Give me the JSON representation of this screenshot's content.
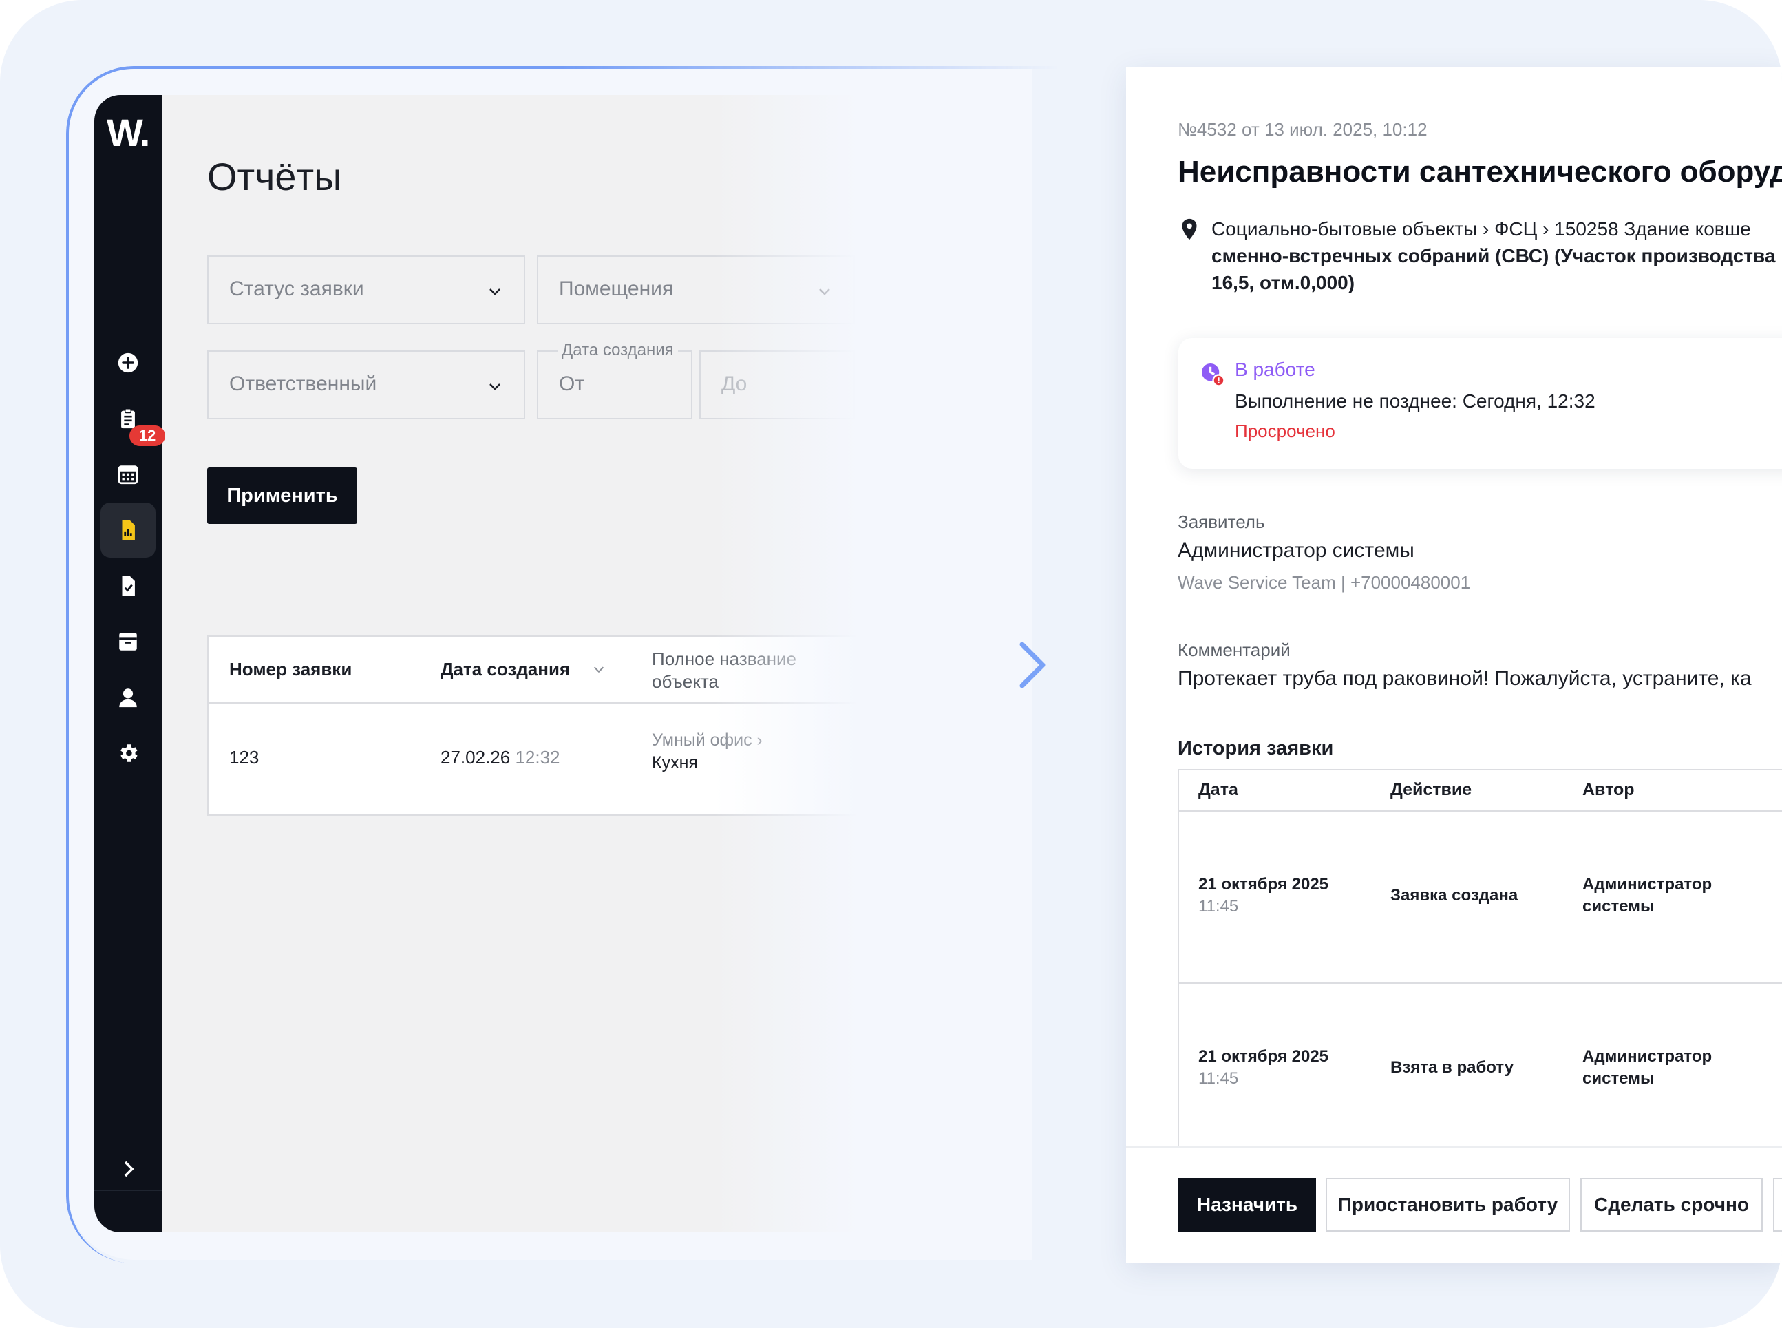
{
  "left_app": {
    "logo": "W.",
    "badge_count": "12",
    "page_title": "Отчёты",
    "filters": {
      "status_placeholder": "Статус заявки",
      "rooms_placeholder": "Помещения",
      "responsible_placeholder": "Ответственный",
      "date_group_label": "Дата создания",
      "date_from_placeholder": "От",
      "date_to_placeholder": "До"
    },
    "apply_label": "Применить",
    "table": {
      "headers": [
        "Номер заявки",
        "Дата создания",
        "Полное название объекта"
      ],
      "rows": [
        {
          "number": "123",
          "date": "27.02.26",
          "time": "12:32",
          "object_path": "Умный офис ›",
          "object_name": "Кухня"
        }
      ]
    }
  },
  "right_panel": {
    "meta": "№4532 от 13 июл. 2025, 10:12",
    "title": "Неисправности сантехнического оборуд",
    "location_line1": "Социально-бытовые объекты › ФСЦ › 150258 Здание ковше",
    "location_line2": "сменно-встречных собраний (СВС) (Участок производства",
    "location_line3": "16,5, отм.0,000)",
    "status": {
      "name": "В работе",
      "deadline": "Выполнение не позднее: Сегодня, 12:32",
      "overdue": "Просрочено"
    },
    "applicant_label": "Заявитель",
    "applicant_name": "Администратор системы",
    "applicant_contact": "Wave Service Team | +70000480001",
    "comment_label": "Комментарий",
    "comment_text": "Протекает труба под раковиной! Пожалуйста, устраните, ка",
    "history_title": "История заявки",
    "history_headers": [
      "Дата",
      "Действие",
      "Автор"
    ],
    "history_rows": [
      {
        "date": "21 октября 2025",
        "time": "11:45",
        "action": "Заявка создана",
        "author_l1": "Администратор",
        "author_l2": "системы"
      },
      {
        "date": "21 октября 2025",
        "time": "11:45",
        "action": "Взята в работу",
        "author_l1": "Администратор",
        "author_l2": "системы"
      }
    ],
    "buttons": {
      "assign": "Назначить",
      "pause": "Приостановить работу",
      "urgent": "Сделать срочно"
    }
  },
  "colors": {
    "dark": "#0d111a",
    "status_purple": "#8e5cf5",
    "overdue_red": "#e5333b",
    "active_icon": "#f5c518",
    "arrow_blue": "#7aa2f7"
  },
  "icons": [
    "plus-circle-icon",
    "clipboard-icon",
    "calendar-icon",
    "report-icon",
    "document-check-icon",
    "archive-icon",
    "user-icon",
    "gear-icon",
    "chevron-right-icon",
    "chevron-down-icon",
    "location-pin-icon",
    "status-in-progress-icon",
    "arrow-right-icon"
  ]
}
